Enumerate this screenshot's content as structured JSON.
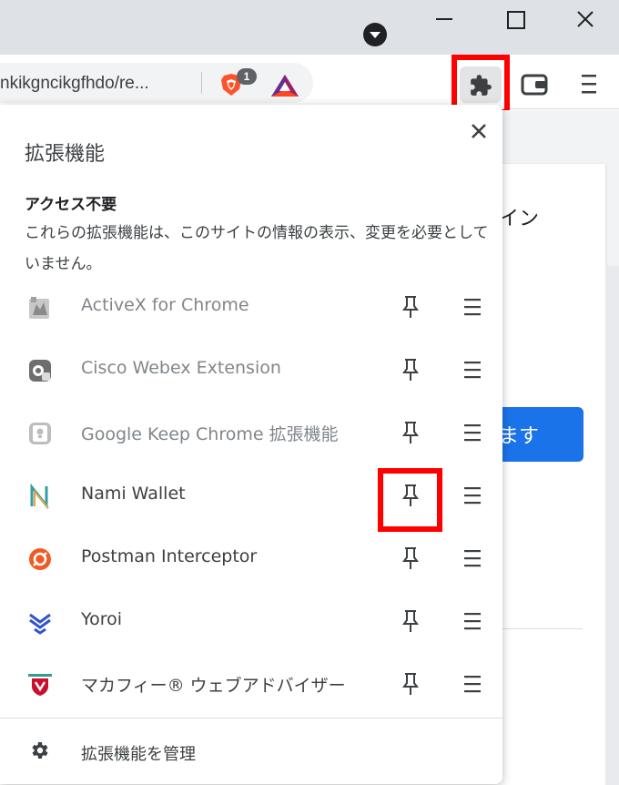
{
  "browser": {
    "url_text": "nkikgncikgfhdo/re...",
    "brave_badge_count": "1",
    "icons": {
      "tab_search": "tab-search-chevron-icon",
      "minimize": "minimize-icon",
      "maximize": "maximize-icon",
      "close": "close-icon",
      "extensions": "puzzle-piece-icon",
      "wallet": "wallet-icon",
      "menu": "kebab-menu-icon"
    }
  },
  "page_behind": {
    "signin_fragment": "イン",
    "button_fragment": "ます"
  },
  "extensions_popup": {
    "title": "拡張機能",
    "section_title": "アクセス不要",
    "section_description": "これらの拡張機能は、このサイトの情報の表示、変更を必要としていません。",
    "items": [
      {
        "name": "ActiveX for Chrome",
        "icon": "activex-icon",
        "muted": true
      },
      {
        "name": "Cisco Webex Extension",
        "icon": "webex-icon",
        "muted": true
      },
      {
        "name": "Google Keep Chrome 拡張機能",
        "icon": "google-keep-icon",
        "muted": true
      },
      {
        "name": "Nami Wallet",
        "icon": "nami-wallet-icon",
        "muted": false
      },
      {
        "name": "Postman Interceptor",
        "icon": "postman-icon",
        "muted": false
      },
      {
        "name": "Yoroi",
        "icon": "yoroi-icon",
        "muted": false
      },
      {
        "name": "マカフィー® ウェブアドバイザー",
        "icon": "mcafee-icon",
        "muted": false
      }
    ],
    "manage_label": "拡張機能を管理"
  },
  "annotation_color": "#ff0000",
  "accent_color": "#1a73e8"
}
